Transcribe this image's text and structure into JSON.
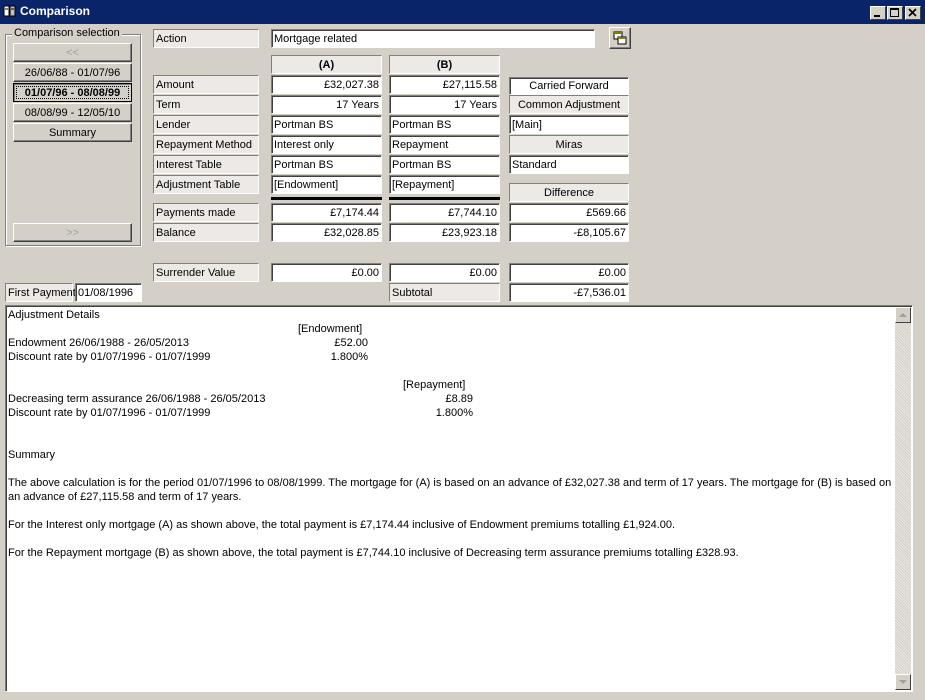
{
  "window": {
    "title": "Comparison"
  },
  "selection": {
    "legend": "Comparison selection",
    "prev_label": "<<",
    "next_label": ">>",
    "items": [
      "26/06/88 - 01/07/96",
      "01/07/96 - 08/08/99",
      "08/08/99 - 12/05/10",
      "Summary"
    ],
    "selected_index": 1
  },
  "action": {
    "label": "Action",
    "value": "Mortgage related"
  },
  "columns": {
    "a": "(A)",
    "b": "(B)"
  },
  "rows": {
    "amount": {
      "label": "Amount",
      "a": "£32,027.38",
      "b": "£27,115.58"
    },
    "term": {
      "label": "Term",
      "a": "17 Years",
      "b": "17 Years"
    },
    "lender": {
      "label": "Lender",
      "a": "Portman BS",
      "b": "Portman BS"
    },
    "repayment_method": {
      "label": "Repayment Method",
      "a": "Interest only",
      "b": "Repayment"
    },
    "interest_table": {
      "label": "Interest Table",
      "a": "Portman BS",
      "b": "Portman BS"
    },
    "adjustment_table": {
      "label": "Adjustment Table",
      "a": "[Endowment]",
      "b": "[Repayment]"
    },
    "payments_made": {
      "label": "Payments made",
      "a": "£7,174.44",
      "b": "£7,744.10",
      "diff": "£569.66"
    },
    "balance": {
      "label": "Balance",
      "a": "£32,028.85",
      "b": "£23,923.18",
      "diff": "-£8,105.67"
    },
    "surrender_value": {
      "label": "Surrender Value",
      "a": "£0.00",
      "b": "£0.00",
      "diff": "£0.00"
    }
  },
  "side": {
    "carried_forward": "Carried Forward",
    "common_adjustment_label": "Common Adjustment",
    "common_adjustment_value": "[Main]",
    "miras_label": "Miras",
    "miras_value": "Standard",
    "difference_label": "Difference"
  },
  "first_payment": {
    "label": "First Payment",
    "value": "01/08/1996"
  },
  "subtotal": {
    "label": "Subtotal",
    "value": "-£7,536.01"
  },
  "details": {
    "heading": "Adjustment Details",
    "endowment_header": "[Endowment]",
    "endowment_line": "Endowment 26/06/1988 - 26/05/2013",
    "endowment_value": "£52.00",
    "discount_line_1": "Discount rate by 01/07/1996 - 01/07/1999",
    "discount_value_1": "1.800%",
    "repayment_header": "[Repayment]",
    "dta_line": "Decreasing term assurance 26/06/1988 - 26/05/2013",
    "dta_value": "£8.89",
    "discount_line_2": "Discount rate by 01/07/1996 - 01/07/1999",
    "discount_value_2": "1.800%",
    "summary_heading": "Summary",
    "summary_p1a": "The above calculation is for the period 01/07/1996 to 08/08/1999. The mortgage for (A) is based on an advance of £32,027.38 and term of 17 years. The mortgage for (B) is based on",
    "summary_p1b": "an advance of £27,115.58 and term of 17 years.",
    "summary_p2": "For the Interest only mortgage (A) as shown above, the total payment is £7,174.44 inclusive of Endowment premiums totalling £1,924.00.",
    "summary_p3": "For the Repayment mortgage (B) as shown above, the total payment is £7,744.10 inclusive of Decreasing term assurance premiums totalling £328.93."
  }
}
